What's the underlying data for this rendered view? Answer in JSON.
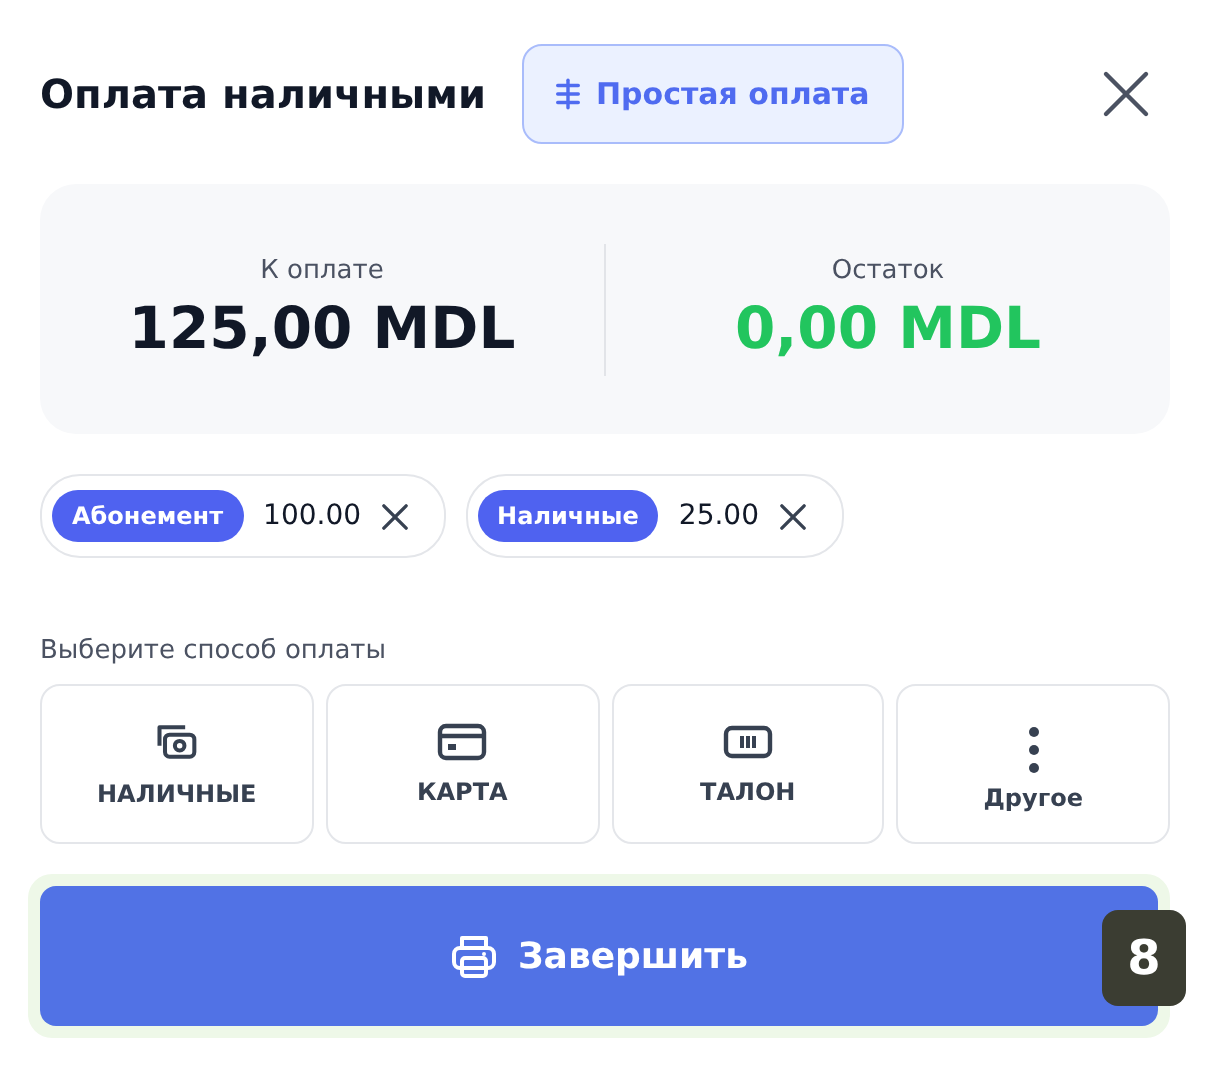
{
  "header": {
    "title": "Оплата наличными",
    "mode_button": "Простая оплата"
  },
  "summary": [
    {
      "label": "К оплате",
      "value": "125,00 MDL",
      "kind": "due"
    },
    {
      "label": "Остаток",
      "value": "0,00 MDL",
      "kind": "rest"
    }
  ],
  "payments": [
    {
      "method": "Абонемент",
      "amount": "100.00"
    },
    {
      "method": "Наличные",
      "amount": "25.00"
    }
  ],
  "methods_label": "Выберите способ оплаты",
  "methods": [
    {
      "label": "НАЛИЧНЫЕ",
      "kind": "cash"
    },
    {
      "label": "КАРТА",
      "kind": "card"
    },
    {
      "label": "ТАЛОН",
      "kind": "ticket"
    },
    {
      "label": "Другое",
      "kind": "more"
    }
  ],
  "finish_button": {
    "label": "Завершить",
    "shortcut": "8"
  }
}
